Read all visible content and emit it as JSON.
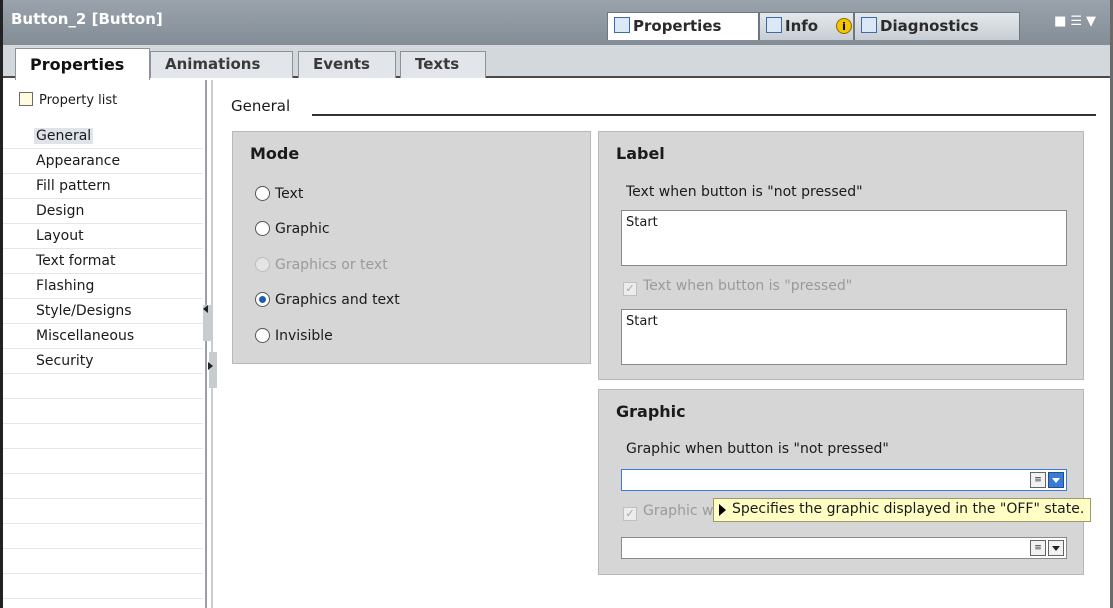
{
  "window": {
    "title": "Button_2 [Button]",
    "top_tabs": [
      {
        "label": "Properties",
        "active": true
      },
      {
        "label": "Info"
      },
      {
        "label": "Diagnostics"
      }
    ]
  },
  "tabs": [
    {
      "label": "Properties",
      "active": true
    },
    {
      "label": "Animations"
    },
    {
      "label": "Events"
    },
    {
      "label": "Texts"
    }
  ],
  "nav": {
    "property_list": "Property list",
    "items": [
      "General",
      "Appearance",
      "Fill pattern",
      "Design",
      "Layout",
      "Text format",
      "Flashing",
      "Style/Designs",
      "Miscellaneous",
      "Security"
    ],
    "selected": "General"
  },
  "section": {
    "title": "General"
  },
  "mode": {
    "title": "Mode",
    "options": [
      {
        "label": "Text",
        "checked": false,
        "disabled": false
      },
      {
        "label": "Graphic",
        "checked": false,
        "disabled": false
      },
      {
        "label": "Graphics or text",
        "checked": false,
        "disabled": true
      },
      {
        "label": "Graphics and text",
        "checked": true,
        "disabled": false
      },
      {
        "label": "Invisible",
        "checked": false,
        "disabled": false
      }
    ]
  },
  "label": {
    "title": "Label",
    "not_pressed_label": "Text when button is \"not pressed\"",
    "not_pressed_value": "Start",
    "pressed_label": "Text when button is \"pressed\"",
    "pressed_checked": true,
    "pressed_value": "Start"
  },
  "graphic": {
    "title": "Graphic",
    "not_pressed_label": "Graphic when button is \"not pressed\"",
    "not_pressed_value": "",
    "pressed_label": "Graphic w",
    "pressed_checked": true,
    "pressed_value": ""
  },
  "tooltip": {
    "text": "Specifies the graphic displayed in the \"OFF\" state."
  },
  "colors": {
    "accent": "#3a7bd5",
    "panel": "#d6d6d6",
    "titlebar": "#8d969f",
    "tooltip": "#ffffc4"
  }
}
